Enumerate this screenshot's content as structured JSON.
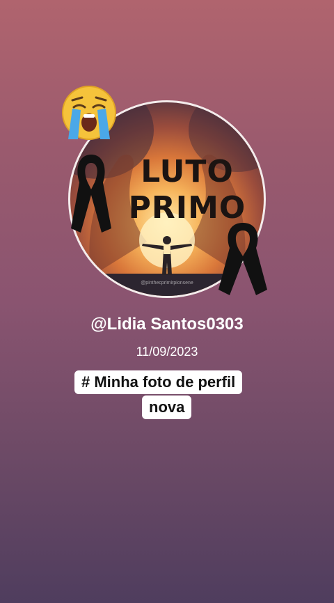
{
  "photo": {
    "title_line1": "LUTO",
    "title_line2": "PRIMO",
    "watermark": "@pinthecprimirpionsene"
  },
  "icons": {
    "emoji": "crying-face-icon",
    "ribbon": "black-mourning-ribbon-icon"
  },
  "post": {
    "username": "@Lidia Santos0303",
    "date": "11/09/2023",
    "caption_line1": "# Minha foto de perfil",
    "caption_line2": "nova"
  },
  "colors": {
    "background_top": "#b0646e",
    "background_bottom": "#4f3d5e",
    "ribbon": "#111111",
    "caption_bg": "#ffffff"
  }
}
